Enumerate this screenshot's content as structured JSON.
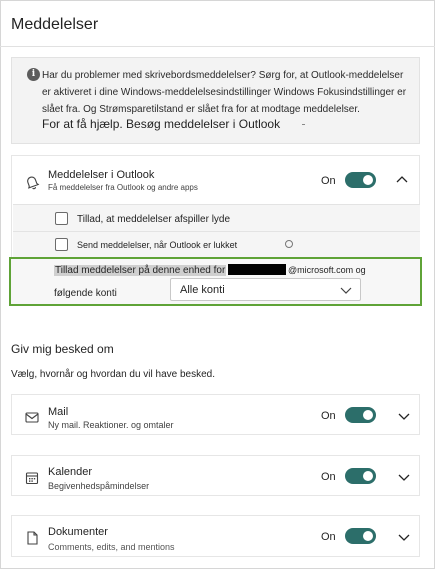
{
  "header": {
    "title": "Meddelelser"
  },
  "info": {
    "icon": "info-icon",
    "text": "Har du problemer med skrivebordsmeddelelser? Sørg for, at Outlook-meddelelser er aktiveret i dine Windows-meddelelsesindstillinger Windows Fokusindstillinger er slået fra. Og Strømsparetilstand er slået fra for at modtage meddelelser.",
    "help": "For at få hjælp. Besøg meddelelser i Outlook"
  },
  "outlook_card": {
    "icon": "notification-bell-icon",
    "title": "Meddelelser i Outlook",
    "subtitle": "Få meddelelser fra Outlook og andre apps",
    "toggle_label": "On",
    "toggle_on": true,
    "checkbox_sound": {
      "label": "Tillad, at meddelelser afspiller lyde",
      "checked": false
    },
    "checkbox_closed": {
      "label": "Send meddelelser, når Outlook er lukket",
      "checked": false
    },
    "allow_text": "Tillad meddelelser på denne enhed for",
    "email_suffix": "@microsoft.com og",
    "following_accounts": "følgende konti",
    "accounts_dropdown": {
      "selected": "Alle konti"
    }
  },
  "notify_section": {
    "title": "Giv mig besked om",
    "description": "Vælg, hvornår og hvordan du vil have besked."
  },
  "categories": [
    {
      "icon": "mail-icon",
      "title": "Mail",
      "subtitle": "Ny mail. Reaktioner. og omtaler",
      "toggle_label": "On",
      "toggle_on": true
    },
    {
      "icon": "calendar-icon",
      "title": "Kalender",
      "subtitle": "Begivenhedspåmindelser",
      "toggle_label": "On",
      "toggle_on": true
    },
    {
      "icon": "document-icon",
      "title": "Dokumenter",
      "subtitle": "Comments, edits, and mentions",
      "toggle_label": "On",
      "toggle_on": true
    }
  ],
  "colors": {
    "toggle_on": "#2c6e6a",
    "highlight_border": "#5fa337"
  }
}
